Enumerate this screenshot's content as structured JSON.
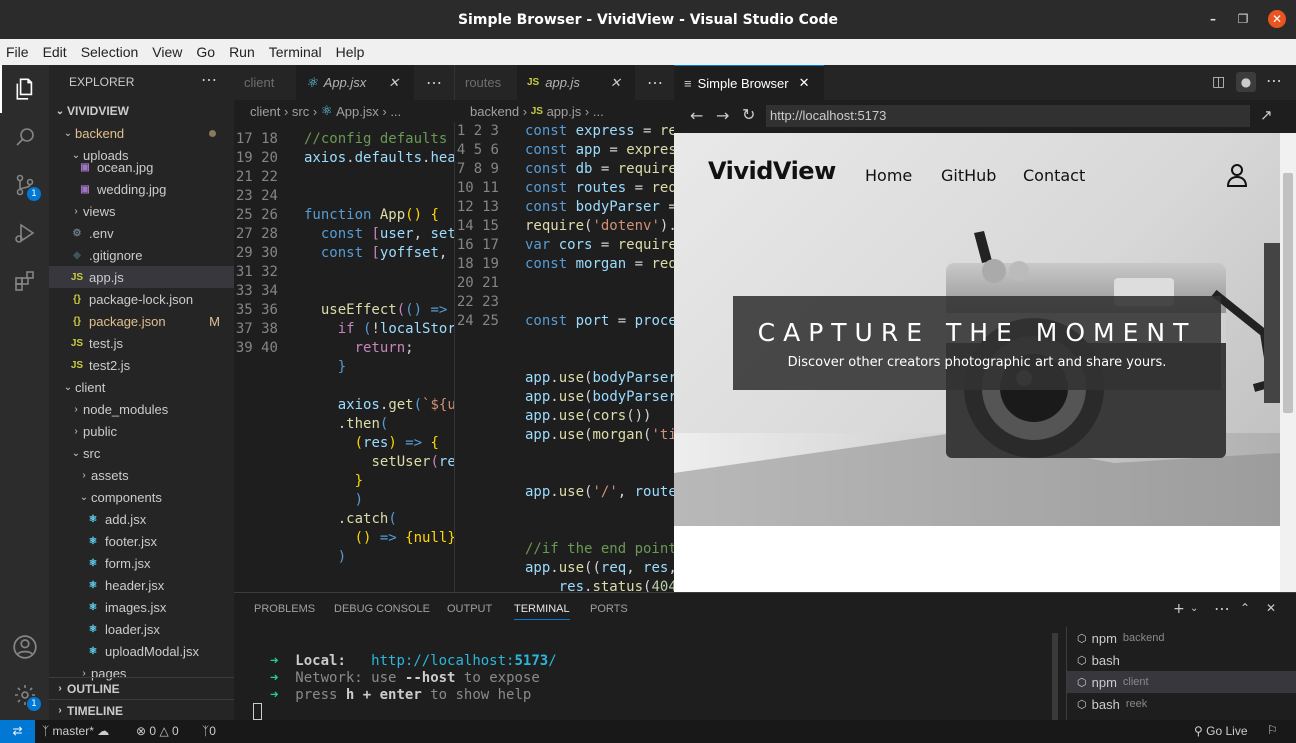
{
  "window": {
    "title": "Simple Browser - VividView - Visual Studio Code"
  },
  "menu": [
    "File",
    "Edit",
    "Selection",
    "View",
    "Go",
    "Run",
    "Terminal",
    "Help"
  ],
  "activity": {
    "scm_badge": "1",
    "settings_badge": "1"
  },
  "sidebar": {
    "header": "EXPLORER",
    "root": "VIVIDVIEW",
    "items": [
      {
        "label": "backend",
        "kind": "folder-open",
        "depth": 1
      },
      {
        "label": "uploads",
        "kind": "folder-open",
        "depth": 2
      },
      {
        "label": "ocean.jpg",
        "kind": "image",
        "depth": 3
      },
      {
        "label": "wedding.jpg",
        "kind": "image",
        "depth": 3
      },
      {
        "label": "views",
        "kind": "folder",
        "depth": 2
      },
      {
        "label": ".env",
        "kind": "gear",
        "depth": 2
      },
      {
        "label": ".gitignore",
        "kind": "git",
        "depth": 2
      },
      {
        "label": "app.js",
        "kind": "js",
        "depth": 2
      },
      {
        "label": "package-lock.json",
        "kind": "json",
        "depth": 2
      },
      {
        "label": "package.json",
        "kind": "json",
        "depth": 2
      },
      {
        "label": "test.js",
        "kind": "js",
        "depth": 2
      },
      {
        "label": "test2.js",
        "kind": "js",
        "depth": 2
      },
      {
        "label": "client",
        "kind": "folder-open",
        "depth": 1
      },
      {
        "label": "node_modules",
        "kind": "folder",
        "depth": 2
      },
      {
        "label": "public",
        "kind": "folder",
        "depth": 2
      },
      {
        "label": "src",
        "kind": "folder-open",
        "depth": 2
      },
      {
        "label": "assets",
        "kind": "folder",
        "depth": 3
      },
      {
        "label": "components",
        "kind": "folder-open",
        "depth": 3
      },
      {
        "label": "add.jsx",
        "kind": "react",
        "depth": 4
      },
      {
        "label": "footer.jsx",
        "kind": "react",
        "depth": 4
      },
      {
        "label": "form.jsx",
        "kind": "react",
        "depth": 4
      },
      {
        "label": "header.jsx",
        "kind": "react",
        "depth": 4
      },
      {
        "label": "images.jsx",
        "kind": "react",
        "depth": 4
      },
      {
        "label": "loader.jsx",
        "kind": "react",
        "depth": 4
      },
      {
        "label": "uploadModal.jsx",
        "kind": "react",
        "depth": 4
      },
      {
        "label": "pages",
        "kind": "folder",
        "depth": 3
      }
    ],
    "package_json_status": "M",
    "outline": "OUTLINE",
    "timeline": "TIMELINE"
  },
  "editor1": {
    "tabs": [
      "client",
      "App.jsx"
    ],
    "breadcrumb": [
      "client",
      "src",
      "App.jsx",
      "..."
    ],
    "line_start": 17,
    "line_end": 40
  },
  "editor2": {
    "tabs": [
      "routes",
      "app.js"
    ],
    "breadcrumb": [
      "backend",
      "app.js",
      "..."
    ],
    "line_start": 1,
    "line_end": 25,
    "current_line": 14
  },
  "browser": {
    "tab_label": "Simple Browser",
    "url": "http://localhost:5173",
    "brand": "VividView",
    "nav": [
      "Home",
      "GitHub",
      "Contact"
    ],
    "headline": "CAPTURE THE MOMENT",
    "subline": "Discover other creators photographic art and share yours."
  },
  "panel": {
    "tabs": [
      "PROBLEMS",
      "DEBUG CONSOLE",
      "OUTPUT",
      "TERMINAL",
      "PORTS"
    ],
    "active_tab": "TERMINAL",
    "lines": {
      "local_label": "Local:",
      "local_url_pre": "http://localhost:",
      "local_port": "5173",
      "local_url_post": "/",
      "network_label": "Network:",
      "network_text_a": "use",
      "network_flag": "--host",
      "network_text_b": "to expose",
      "help_a": "press",
      "help_key": "h + enter",
      "help_b": "to show help"
    },
    "terminals": [
      {
        "name": "npm",
        "detail": "backend"
      },
      {
        "name": "bash",
        "detail": ""
      },
      {
        "name": "npm",
        "detail": "client"
      },
      {
        "name": "bash",
        "detail": "reek"
      }
    ]
  },
  "status": {
    "branch": "master*",
    "errors": "0",
    "warnings": "0",
    "ports": "0",
    "golive": "Go Live"
  }
}
